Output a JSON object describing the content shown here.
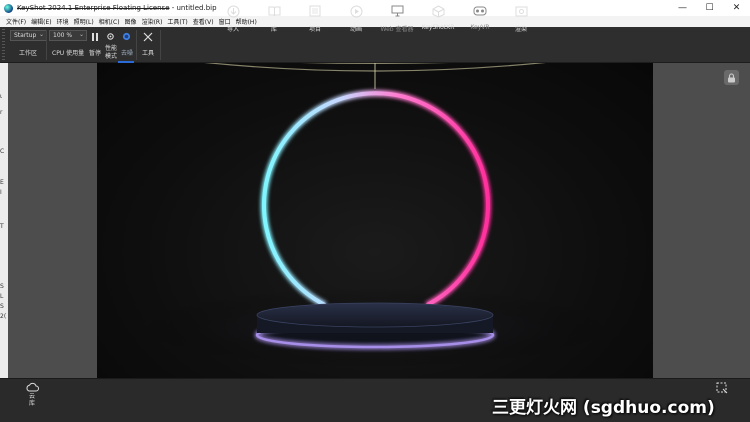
{
  "window": {
    "title_struck": "KeyShot 2024.1 Enterprise Floating License",
    "title_file": " - untitled.bip",
    "minimize": "—",
    "maximize": "☐",
    "close": "✕"
  },
  "menu": [
    "文件(F)",
    "编辑(E)",
    "环境",
    "照明(L)",
    "相机(C)",
    "图像",
    "渲染(R)",
    "工具(T)",
    "查看(V)",
    "窗口",
    "帮助(H)"
  ],
  "ribbon": {
    "workspace_select": "Startup",
    "workspace_label": "工作区",
    "zoom_select": "100 %",
    "cpu_label": "CPU 使用量",
    "pause_label": "暂停",
    "perf_label_1": "性能",
    "perf_label_2": "模式",
    "mode_label": "去噪",
    "tools_label": "工具"
  },
  "left_strip": [
    "ι",
    "r",
    "C",
    "E",
    "I",
    "T",
    "S",
    "L",
    "S",
    "2("
  ],
  "bottom": {
    "cloud_label": "云库",
    "items": [
      {
        "label": "导入",
        "icon": "import-icon"
      },
      {
        "label": "库",
        "icon": "book-icon"
      },
      {
        "label": "项目",
        "icon": "list-icon"
      },
      {
        "label": "动画",
        "icon": "play-icon"
      },
      {
        "label": "Web 查看器",
        "icon": "monitor-icon"
      },
      {
        "label": "KeyShotXR",
        "icon": "cube-icon"
      },
      {
        "label": "KeyVR",
        "icon": "vr-icon"
      },
      {
        "label": "渲染",
        "icon": "render-icon"
      }
    ]
  },
  "watermark": "三更灯火网 (sgdhuo.com)",
  "colors": {
    "ring_cyan": "#5ff2ff",
    "ring_pink": "#ff3ba8",
    "platform_glow": "#b89cff",
    "accent": "#2a6ad6"
  }
}
